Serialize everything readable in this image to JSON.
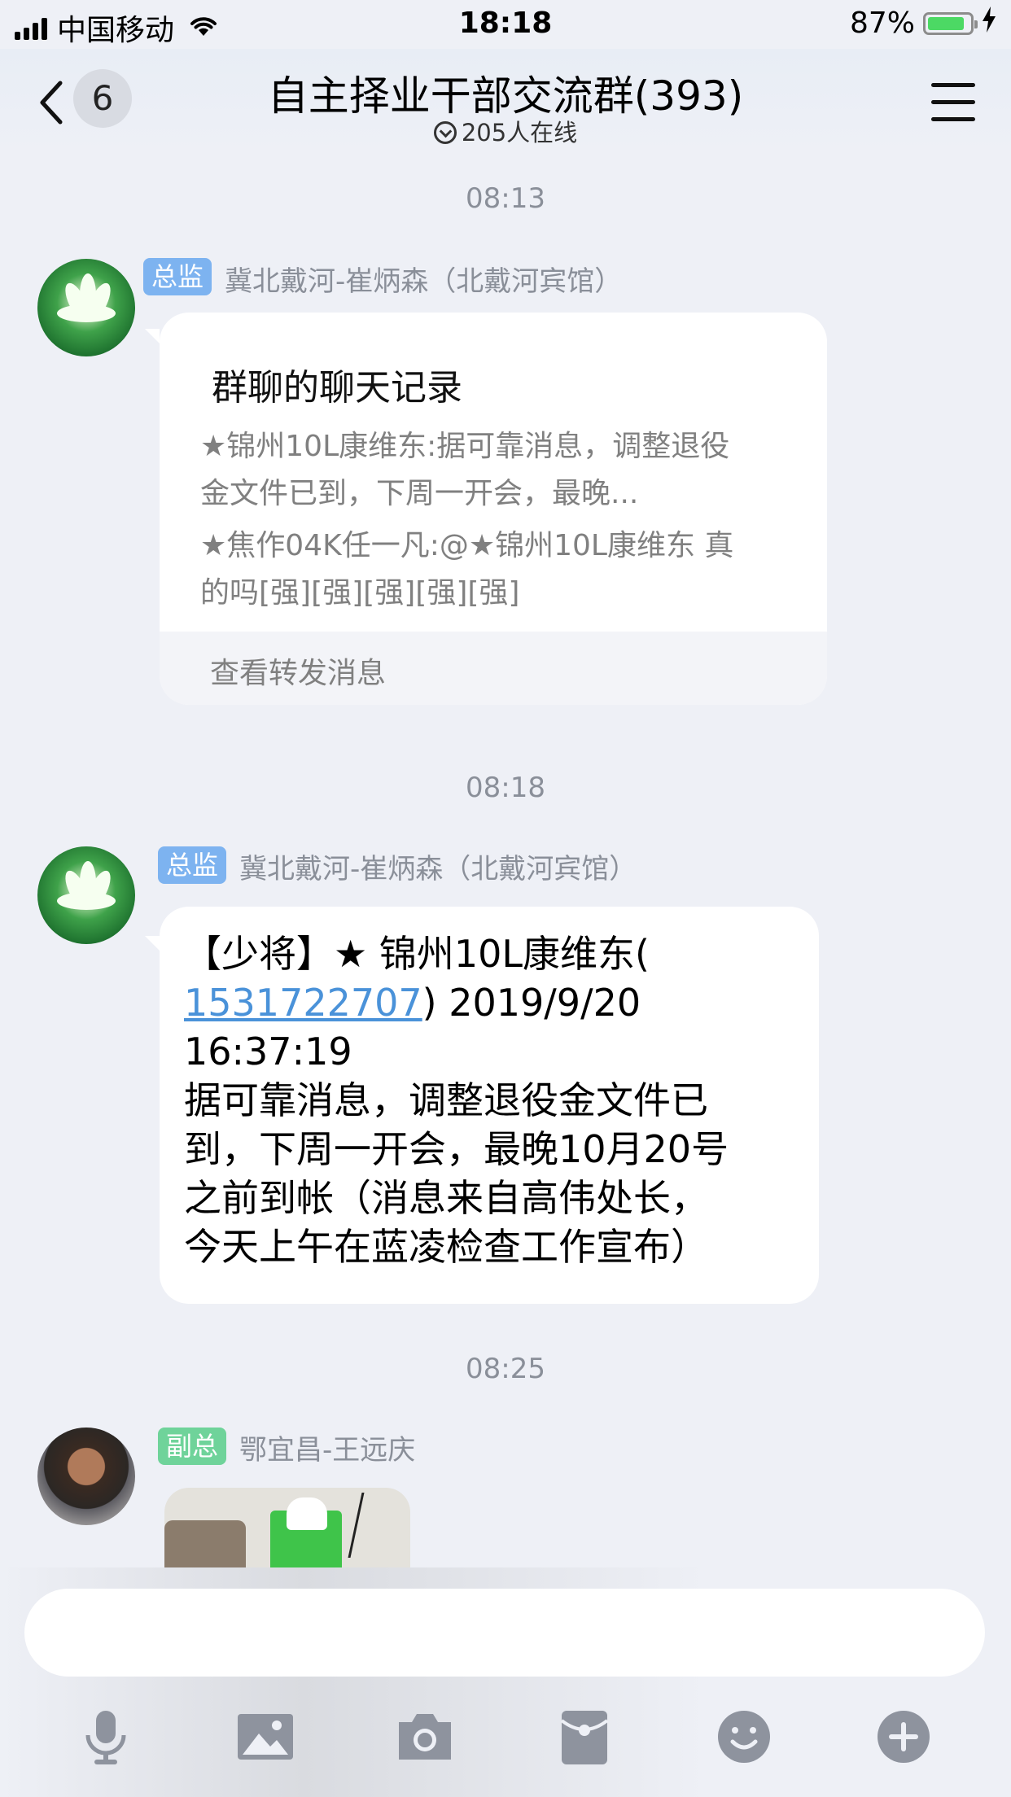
{
  "status_bar": {
    "carrier": "中国移动",
    "time": "18:18",
    "battery": "87%",
    "battery_level": 0.87
  },
  "header": {
    "unread_count": "6",
    "title": "自主择业干部交流群(393)",
    "online": "205人在线",
    "icons": [
      "back-icon",
      "online-icon",
      "menu-icon"
    ]
  },
  "messages": [
    {
      "time": "08:13",
      "role_tag": "总监",
      "sender": "冀北戴河-崔炳森（北戴河宾馆）",
      "forward": {
        "title": "群聊的聊天记录",
        "line1a": "★锦州10L康维东:据可靠消息，调整退役",
        "line1b": "金文件已到，下周一开会，最晚...",
        "line2a": "★焦作04K任一凡:@★锦州10L康维东 真",
        "line2b": "的吗[强][强][强][强][强]",
        "footer": "查看转发消息"
      }
    },
    {
      "time": "08:18",
      "role_tag": "总监",
      "sender": "冀北戴河-崔炳森（北戴河宾馆）",
      "text": {
        "l1": "【少将】★ 锦州10L康维东(",
        "link": "1531722707",
        "l2_rest": ") 2019/9/20",
        "l3": "16:37:19",
        "l4": "据可靠消息，调整退役金文件已",
        "l5": "到，下周一开会，最晚10月20号",
        "l6": "之前到帐（消息来自高伟处长，",
        "l7": "今天上午在蓝凌检查工作宣布）"
      }
    },
    {
      "time": "08:25",
      "role_tag": "副总",
      "sender": "鄂宜昌-王远庆"
    }
  ],
  "colors": {
    "background": "#eef0f6",
    "tag_blue": "#7db3f0",
    "tag_green": "#6fd39a",
    "link": "#4a92d9",
    "battery": "#4cd964",
    "icon_gray": "#8e939e"
  },
  "toolbar": {
    "icons": [
      "microphone-icon",
      "image-icon",
      "camera-icon",
      "red-packet-icon",
      "emoji-icon",
      "plus-icon"
    ]
  }
}
